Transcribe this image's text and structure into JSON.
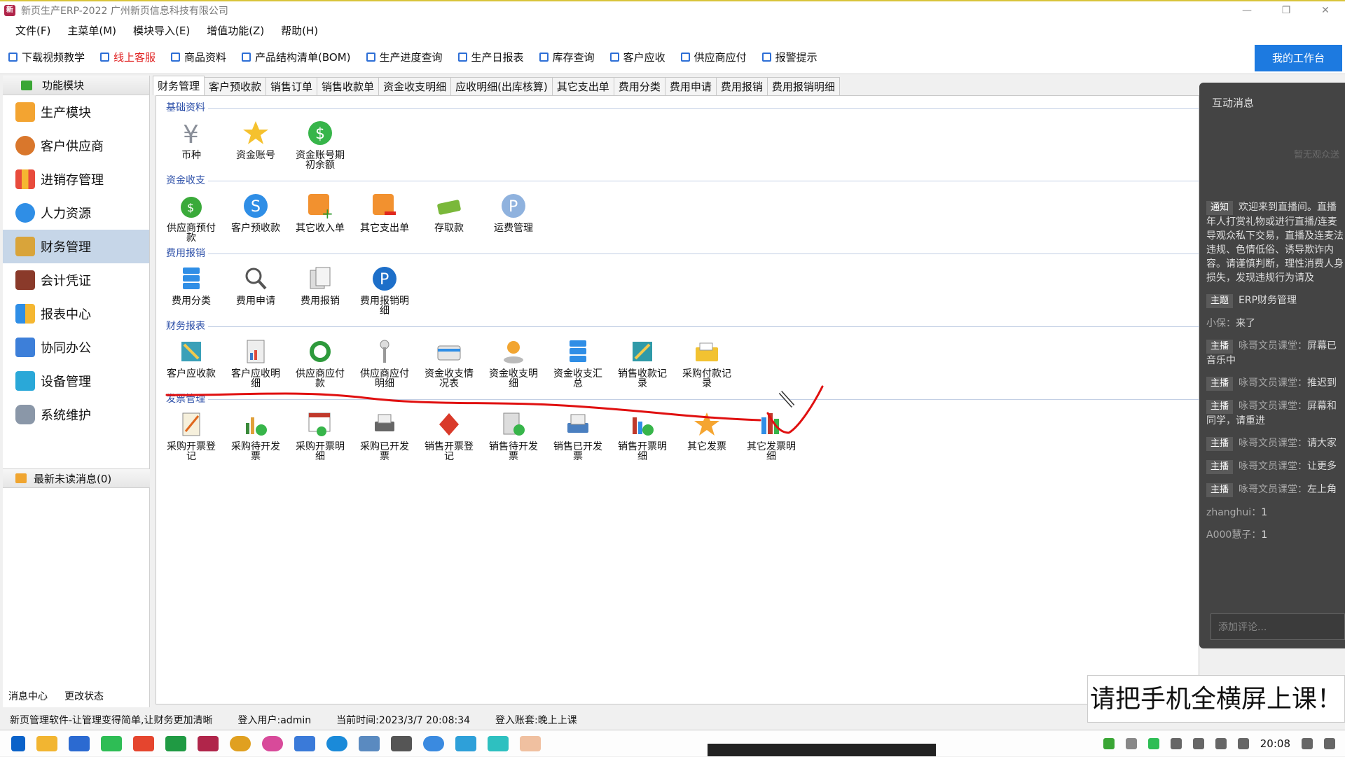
{
  "window": {
    "title": "新页生产ERP-2022 广州新页信息科技有限公司",
    "min": "—",
    "max": "❐",
    "close": "✕"
  },
  "menu": [
    "文件(F)",
    "主菜单(M)",
    "模块导入(E)",
    "增值功能(Z)",
    "帮助(H)"
  ],
  "toolbar": {
    "items": [
      "下载视频教学",
      "线上客服",
      "商品资料",
      "产品结构清单(BOM)",
      "生产进度查询",
      "生产日报表",
      "库存查询",
      "客户应收",
      "供应商应付",
      "报警提示"
    ],
    "workbench": "我的工作台",
    "highlight_color": "#e02020"
  },
  "sidebar": {
    "header": "功能模块",
    "items": [
      "生产模块",
      "客户供应商",
      "进销存管理",
      "人力资源",
      "财务管理",
      "会计凭证",
      "报表中心",
      "协同办公",
      "设备管理",
      "系统维护"
    ],
    "active": "财务管理",
    "unread": "最新未读消息(0)",
    "footer": [
      "消息中心",
      "更改状态"
    ]
  },
  "tabs": [
    "财务管理",
    "客户预收款",
    "销售订单",
    "销售收款单",
    "资金收支明细",
    "应收明细(出库核算)",
    "其它支出单",
    "费用分类",
    "费用申请",
    "费用报销",
    "费用报销明细"
  ],
  "groups": [
    {
      "title": "基础资料",
      "items": [
        "币种",
        "资金账号",
        "资金账号期初余额"
      ]
    },
    {
      "title": "资金收支",
      "items": [
        "供应商预付款",
        "客户预收款",
        "其它收入单",
        "其它支出单",
        "存取款",
        "运费管理"
      ]
    },
    {
      "title": "费用报销",
      "items": [
        "费用分类",
        "费用申请",
        "费用报销",
        "费用报销明细"
      ]
    },
    {
      "title": "财务报表",
      "items": [
        "客户应收款",
        "客户应收明细",
        "供应商应付款",
        "供应商应付明细",
        "资金收支情况表",
        "资金收支明细",
        "资金收支汇总",
        "销售收款记录",
        "采购付款记录"
      ]
    },
    {
      "title": "发票管理",
      "items": [
        "采购开票登记",
        "采购待开发票",
        "采购开票明细",
        "采购已开发票",
        "销售开票登记",
        "销售待开发票",
        "销售已开发票",
        "销售开票明细",
        "其它发票",
        "其它发票明细"
      ]
    }
  ],
  "live": {
    "title": "互动消息",
    "empty": "暂无观众送",
    "notice_tag": "通知",
    "notice": "欢迎来到直播间。直播年人打赏礼物或进行直播/连麦导观众私下交易，直播及连麦法违规、色情低俗、诱导欺诈内容。请谨慎判断，理性消费人身损失，发现违规行为请及",
    "messages": [
      {
        "tag": "主题",
        "text": "ERP财务管理"
      },
      {
        "tag": "",
        "name": "小保：",
        "text": "来了"
      },
      {
        "tag": "主播",
        "name": "咏哥文员课堂：",
        "text": "屏幕已音乐中"
      },
      {
        "tag": "主播",
        "name": "咏哥文员课堂：",
        "text": "推迟到"
      },
      {
        "tag": "主播",
        "name": "咏哥文员课堂：",
        "text": "屏幕和同学，请重进"
      },
      {
        "tag": "主播",
        "name": "咏哥文员课堂：",
        "text": "请大家"
      },
      {
        "tag": "主播",
        "name": "咏哥文员课堂：",
        "text": "让更多"
      },
      {
        "tag": "主播",
        "name": "咏哥文员课堂：",
        "text": "左上角"
      },
      {
        "tag": "",
        "name": "zhanghui：",
        "text": "1"
      },
      {
        "tag": "",
        "name": "A000慧子：",
        "text": "1"
      }
    ],
    "comment_placeholder": "添加评论..."
  },
  "status": {
    "slogan": "新页管理软件-让管理变得简单,让财务更加清晰",
    "user": "登入用户:admin",
    "time": "当前时间:2023/3/7 20:08:34",
    "account": "登入账套:晚上上课"
  },
  "banner": "请把手机全横屏上课！",
  "taskbar": {
    "clock": "20:08"
  },
  "annotation_color": "#e01010"
}
